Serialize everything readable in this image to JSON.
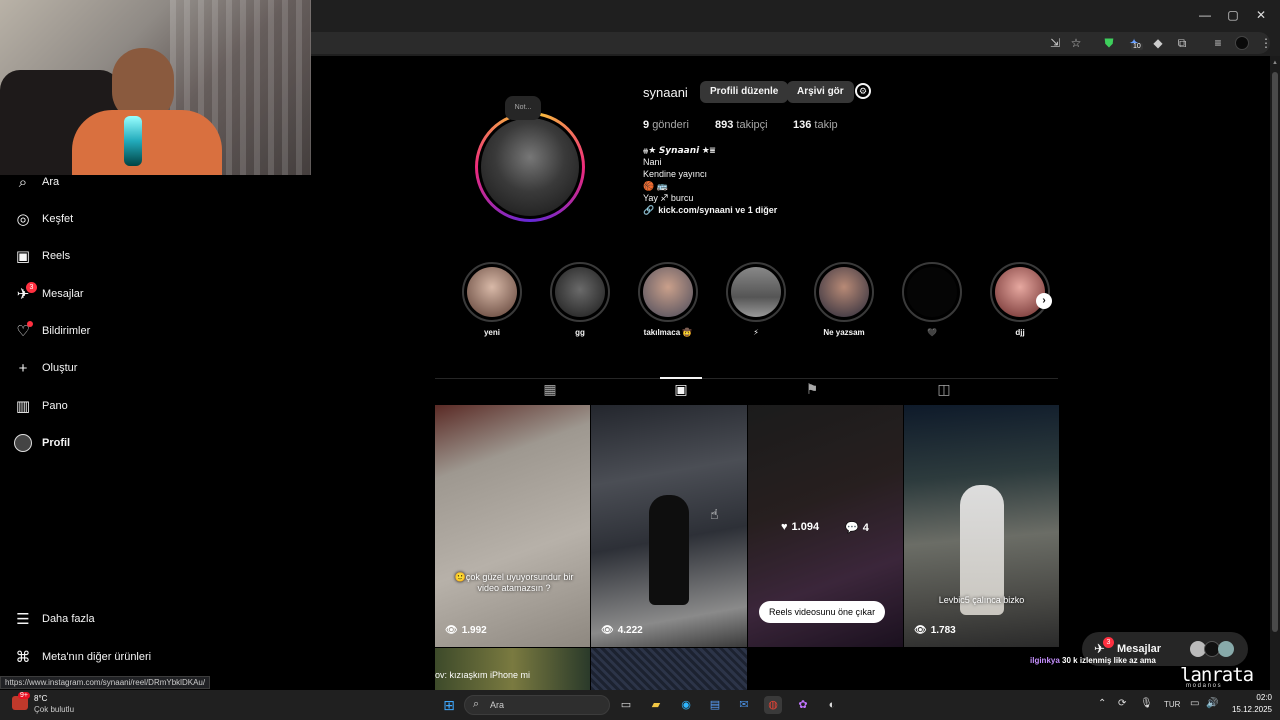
{
  "browser": {
    "window_controls": {
      "minimize": "—",
      "maximize": "▢",
      "close": "✕"
    },
    "extension_badge": "10"
  },
  "sidebar": {
    "items": [
      {
        "label": "Ara",
        "icon": "search-icon",
        "glyph": "⌕"
      },
      {
        "label": "Keşfet",
        "icon": "compass-icon",
        "glyph": "◎"
      },
      {
        "label": "Reels",
        "icon": "reels-icon",
        "glyph": "▣"
      },
      {
        "label": "Mesajlar",
        "icon": "messenger-icon",
        "glyph": "✈",
        "badge": "3"
      },
      {
        "label": "Bildirimler",
        "icon": "heart-icon",
        "glyph": "♡"
      },
      {
        "label": "Oluştur",
        "icon": "plus-icon",
        "glyph": "+"
      },
      {
        "label": "Pano",
        "icon": "dashboard-icon",
        "glyph": "▥"
      },
      {
        "label": "Profil",
        "icon": "profile-avatar-icon",
        "glyph": "●"
      }
    ],
    "more": {
      "label": "Daha fazla",
      "glyph": "☰"
    },
    "meta": {
      "label": "Meta'nın diğer ürünleri",
      "glyph": "⌘"
    }
  },
  "profile": {
    "note": "Not...",
    "username": "synaani",
    "edit_button": "Profili düzenle",
    "archive_button": "Arşivi gör",
    "stats": [
      {
        "value": "9",
        "label": "gönderi"
      },
      {
        "value": "893",
        "label": "takipçi"
      },
      {
        "value": "136",
        "label": "takip"
      }
    ],
    "bio": {
      "name": "⩷★ 𝙎𝙮𝙣𝙖𝙖𝙣𝙞 ★⩸",
      "line1": "Nani",
      "line2": "Kendine yayıncı",
      "line3": "🏀 🚌",
      "line4": "Yay ♐ burcu",
      "link": "kick.com/synaani ve 1 diğer"
    }
  },
  "highlights": [
    {
      "label": "yeni"
    },
    {
      "label": "gg"
    },
    {
      "label": "takılmaca 🤠"
    },
    {
      "label": "⚡"
    },
    {
      "label": "Ne yazsam"
    },
    {
      "label": "🖤"
    },
    {
      "label": "djj"
    }
  ],
  "reels": [
    {
      "caption": "🙂çok güzel uyuyorsundur bir video atamazsın ?",
      "views": "1.992"
    },
    {
      "caption": "",
      "views": "4.222"
    },
    {
      "likes": "1.094",
      "comments": "4",
      "pin_label": "Reels videosunu öne çıkar"
    },
    {
      "caption": "Levbic5 çalınca bizko",
      "views": "1.783"
    }
  ],
  "row2": {
    "caption": "ov: kızıaşkım iPhone mi"
  },
  "messages_bar": {
    "label": "Mesajlar",
    "badge": "3"
  },
  "stream_overlay": {
    "user": "ilginkya",
    "text": "30 k izlenmiş like az ama",
    "brand_top": "lanrata",
    "brand_bottom": "m  o  d  a  n  o  s"
  },
  "status_url": "https://www.instagram.com/synaani/reel/DRmYbklDKAu/",
  "taskbar": {
    "weather_badge": "9+",
    "temperature": "8°C",
    "condition": "Çok bulutlu",
    "search_placeholder": "Ara",
    "lang": "TUR",
    "time": "02:0",
    "date": "15.12.2025"
  }
}
